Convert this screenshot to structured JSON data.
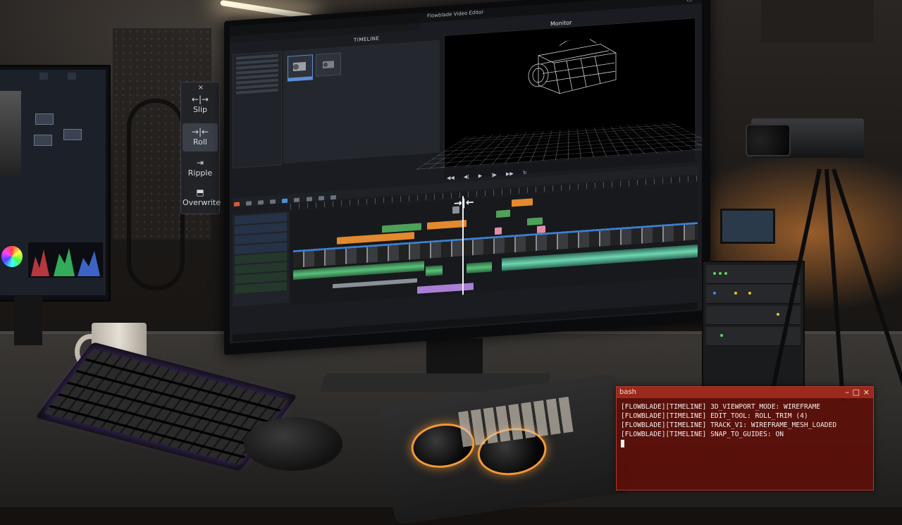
{
  "editor": {
    "app_title": "Flowblade Video Editor",
    "timeline_label": "TIMELINE",
    "monitor_label": "Monitor",
    "transport_icons": [
      "rewind-icon",
      "prev-frame-icon",
      "play-icon",
      "next-frame-icon",
      "fast-forward-icon",
      "loop-icon"
    ]
  },
  "tool_palette": {
    "close_glyph": "×",
    "items": [
      {
        "label": "Slip",
        "glyph": "←|→",
        "active": false
      },
      {
        "label": "Roll",
        "glyph": "→|←",
        "active": true
      },
      {
        "label": "Ripple",
        "glyph": "⇥",
        "active": false
      },
      {
        "label": "Overwrite",
        "glyph": "⬒",
        "active": false
      }
    ]
  },
  "terminal": {
    "title": "bash",
    "controls": {
      "minimize": "–",
      "maximize": "□",
      "close": "×"
    },
    "lines": [
      "[FLOWBLADE][TIMELINE] 3D_VIEWPORT_MODE: WIREFRAME",
      "[FLOWBLADE][TIMELINE] EDIT_TOOL: ROLL_TRIM (4)",
      "[FLOWBLADE][TIMELINE] TRACK_V1: WIREFRAME_MESH_LOADED",
      "[FLOWBLADE][TIMELINE] SNAP_TO_GUIDES: ON"
    ]
  },
  "colors": {
    "terminal_bg": "#600e08",
    "terminal_titlebar": "#9c2a1c",
    "clip_orange": "#e3892f",
    "clip_green": "#4fa15a",
    "clip_pink": "#e08fa9",
    "clip_purple": "#a97fd6",
    "video_track_blue": "#3e7fd0",
    "controller_glow": "#f39a3a"
  }
}
